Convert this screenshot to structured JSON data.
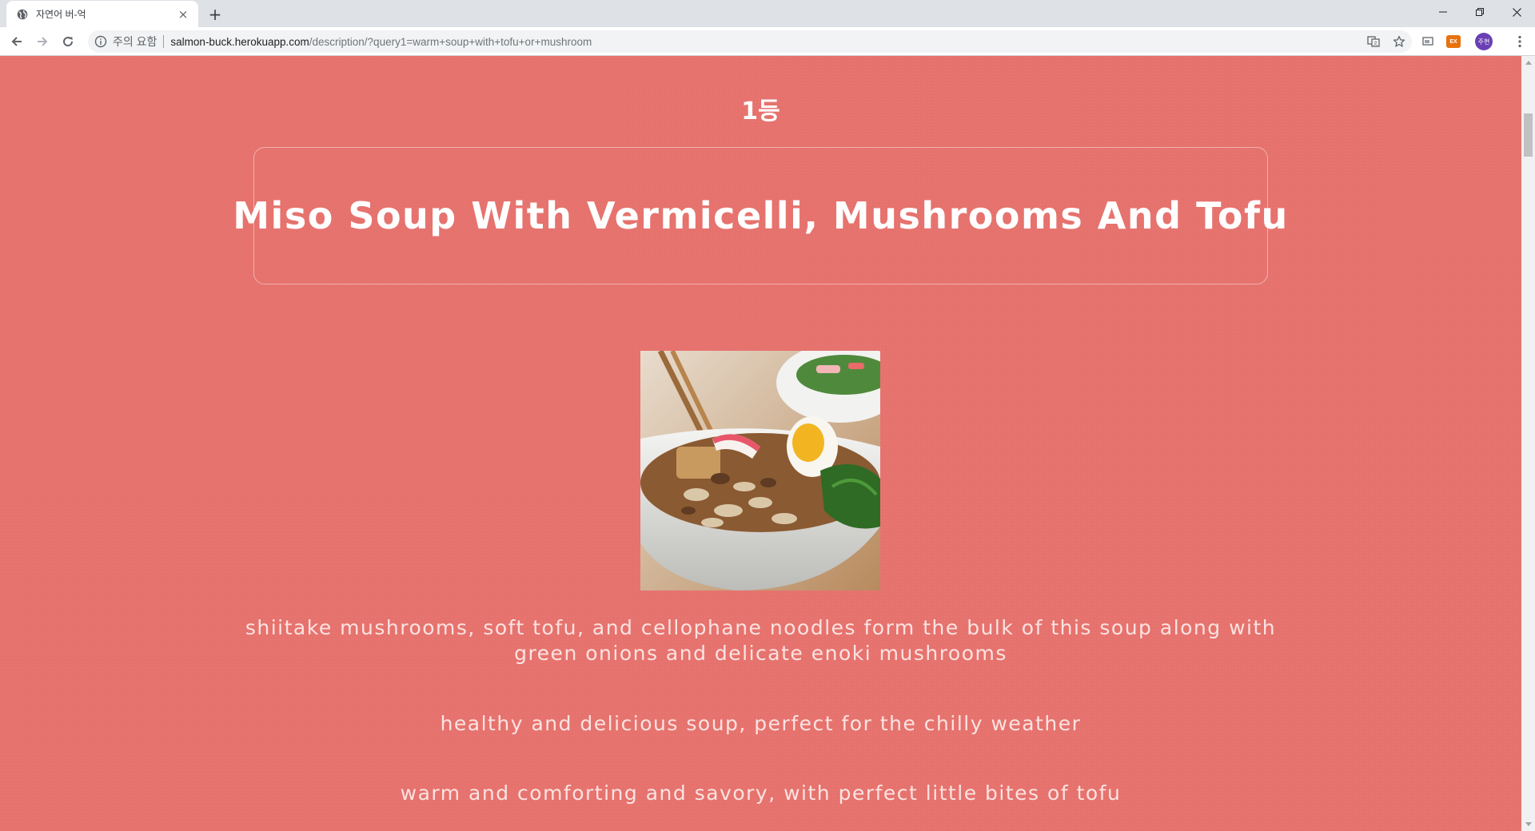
{
  "browser": {
    "tab_title": "자연어 버-억",
    "new_tab_symbol": "+",
    "tab_close_symbol": "×",
    "security_label": "주의 요함",
    "url_host": "salmon-buck.herokuapp.com",
    "url_path": "/description/?query1=warm+soup+with+tofu+or+mushroom",
    "extension_badge": "EX",
    "profile_initials": "주현"
  },
  "page": {
    "rank_label": "1등",
    "recipe_title": "Miso Soup With Vermicelli, Mushrooms And Tofu",
    "descriptions": [
      "shiitake mushrooms, soft tofu, and cellophane noodles form the bulk of this soup along with green onions and delicate enoki mushrooms",
      "healthy and delicious soup, perfect for the chilly weather",
      "warm and comforting and savory, with perfect little bites of tofu"
    ],
    "background_color": "#e6726d"
  },
  "icons": {
    "favicon": "globe-icon",
    "back": "arrow-left-icon",
    "forward": "arrow-right-icon",
    "reload": "reload-icon",
    "info": "info-icon",
    "translate": "translate-icon",
    "bookmark": "star-icon",
    "cast": "cast-icon",
    "menu": "kebab-menu-icon"
  }
}
